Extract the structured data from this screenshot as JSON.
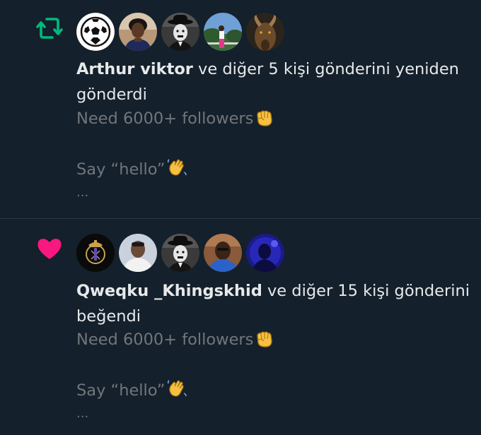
{
  "notifications": [
    {
      "type": "repost",
      "icon": "repost-icon",
      "icon_color": "#00ba7c",
      "avatars": [
        "soccer-ball-avatar",
        "woman-avatar",
        "chaplin-avatar",
        "outdoor-avatar",
        "goat-avatar"
      ],
      "user": "Arthur viktor",
      "action": " ve diğer 5 kişi gönderini yeniden gönderdi",
      "preview_line1": "Need  6000+ followers",
      "preview_line2": "Say “hello”",
      "ellipsis": "..."
    },
    {
      "type": "like",
      "icon": "heart-icon",
      "icon_color": "#f91880",
      "avatars": [
        "real-madrid-avatar",
        "man-avatar",
        "chaplin-avatar",
        "man-glasses-avatar",
        "purple-avatar"
      ],
      "user": "Qweqku _Khingskhid",
      "action": " ve diğer 15 kişi gönderini beğendi",
      "preview_line1": "Need  6000+ followers",
      "preview_line2": "Say “hello”",
      "ellipsis": "..."
    }
  ]
}
